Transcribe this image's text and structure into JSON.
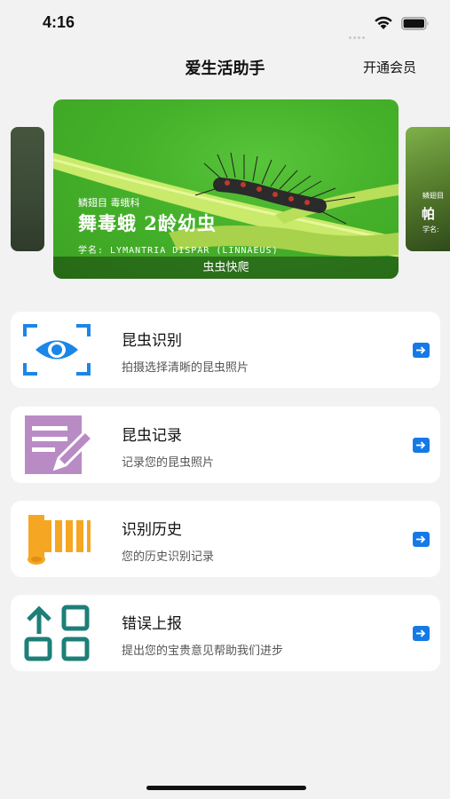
{
  "status_bar": {
    "time": "4:16"
  },
  "nav": {
    "title": "爱生活助手",
    "right_action": "开通会员"
  },
  "banner": {
    "order_family": "鳞翅目 毒蛾科",
    "name": "舞毒蛾 2龄幼虫",
    "scientific_name": "学名: LYMANTRIA DISPAR (LINNAEUS)",
    "caption": "虫虫快爬",
    "right_peek": {
      "order": "鳞翅目",
      "name": "帕",
      "sci": "学名:"
    }
  },
  "menu": [
    {
      "title": "昆虫识别",
      "subtitle": "拍摄选择清晰的昆虫照片",
      "icon": "eye-scan-icon"
    },
    {
      "title": "昆虫记录",
      "subtitle": "记录您的昆虫照片",
      "icon": "note-edit-icon"
    },
    {
      "title": "识别历史",
      "subtitle": "您的历史识别记录",
      "icon": "history-scroll-icon"
    },
    {
      "title": "错误上报",
      "subtitle": "提出您的宝贵意见帮助我们进步",
      "icon": "report-grid-icon"
    }
  ],
  "colors": {
    "accent": "#1579e6",
    "eye_blue": "#1a86e8",
    "purple": "#b98bc4",
    "orange": "#f5a623",
    "teal": "#1d7f78"
  }
}
